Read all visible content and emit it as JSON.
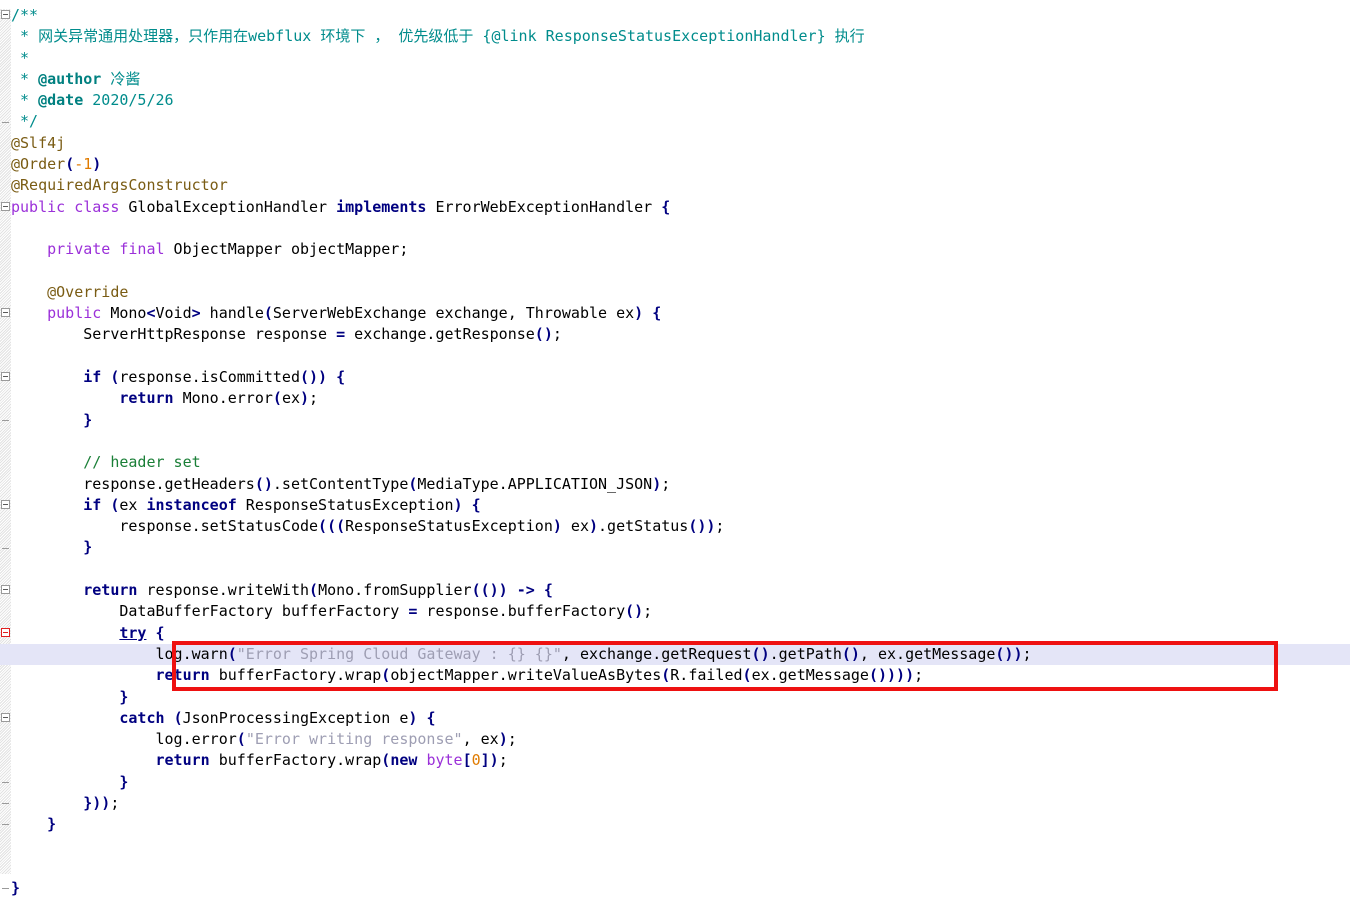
{
  "app": {
    "kind": "code-editor",
    "language": "Java",
    "theme": "light"
  },
  "colors": {
    "background": "#ffffff",
    "gutter": "#e2e2e2",
    "javadoc": "#008c8c",
    "comment": "#1a7f37",
    "annotation": "#7a5c14",
    "keyword": "#000080",
    "modifier": "#9b30d9",
    "number": "#e07b00",
    "string": "#9e9eb3",
    "line_highlight": "#e4e5f7",
    "callout_box": "#ee1111"
  },
  "callout": {
    "label": "red-highlight-box",
    "color": "#ee1111",
    "covers_lines": [
      31,
      32
    ]
  },
  "code": {
    "lines": [
      {
        "n": 1,
        "fold": "open",
        "tokens": [
          {
            "t": "/**",
            "c": "k-doc"
          }
        ]
      },
      {
        "n": 2,
        "fold": "none",
        "tokens": [
          {
            "t": " * 网关异常通用处理器，只作用在webflux 环境下 ， 优先级低于 {@link ResponseStatusExceptionHandler} 执行",
            "c": "k-doc"
          }
        ]
      },
      {
        "n": 3,
        "fold": "none",
        "tokens": [
          {
            "t": " *",
            "c": "k-doc"
          }
        ]
      },
      {
        "n": 4,
        "fold": "none",
        "tokens": [
          {
            "t": " * ",
            "c": "k-doc"
          },
          {
            "t": "@author",
            "c": "k-doctag"
          },
          {
            "t": " 冷酱",
            "c": "k-doc"
          }
        ]
      },
      {
        "n": 5,
        "fold": "none",
        "tokens": [
          {
            "t": " * ",
            "c": "k-doc"
          },
          {
            "t": "@date",
            "c": "k-doctag"
          },
          {
            "t": " 2020/5/26",
            "c": "k-doc"
          }
        ]
      },
      {
        "n": 6,
        "fold": "tick",
        "tokens": [
          {
            "t": " */",
            "c": "k-doc"
          }
        ]
      },
      {
        "n": 7,
        "fold": "none",
        "tokens": [
          {
            "t": "@Slf4j",
            "c": "k-anno"
          }
        ]
      },
      {
        "n": 8,
        "fold": "none",
        "tokens": [
          {
            "t": "@Order",
            "c": "k-anno"
          },
          {
            "t": "(",
            "c": "k-op"
          },
          {
            "t": "-1",
            "c": "k-num"
          },
          {
            "t": ")",
            "c": "k-op"
          }
        ]
      },
      {
        "n": 9,
        "fold": "none",
        "tokens": [
          {
            "t": "@RequiredArgsConstructor",
            "c": "k-anno"
          }
        ]
      },
      {
        "n": 10,
        "fold": "open",
        "tokens": [
          {
            "t": "public class",
            "c": "k-mod"
          },
          {
            "t": " GlobalExceptionHandler ",
            "c": "k-plain"
          },
          {
            "t": "implements",
            "c": "k-kw"
          },
          {
            "t": " ErrorWebExceptionHandler ",
            "c": "k-plain"
          },
          {
            "t": "{",
            "c": "k-op"
          }
        ]
      },
      {
        "n": 11,
        "fold": "none",
        "tokens": []
      },
      {
        "n": 12,
        "fold": "none",
        "tokens": [
          {
            "t": "    ",
            "c": "k-plain"
          },
          {
            "t": "private final",
            "c": "k-mod"
          },
          {
            "t": " ObjectMapper objectMapper;",
            "c": "k-plain"
          }
        ]
      },
      {
        "n": 13,
        "fold": "none",
        "tokens": []
      },
      {
        "n": 14,
        "fold": "none",
        "tokens": [
          {
            "t": "    @Override",
            "c": "k-anno"
          }
        ]
      },
      {
        "n": 15,
        "fold": "open",
        "tokens": [
          {
            "t": "    ",
            "c": "k-plain"
          },
          {
            "t": "public",
            "c": "k-mod"
          },
          {
            "t": " Mono",
            "c": "k-plain"
          },
          {
            "t": "<",
            "c": "k-op"
          },
          {
            "t": "Void",
            "c": "k-plain"
          },
          {
            "t": ">",
            "c": "k-op"
          },
          {
            "t": " handle",
            "c": "k-plain"
          },
          {
            "t": "(",
            "c": "k-op"
          },
          {
            "t": "ServerWebExchange exchange, Throwable ex",
            "c": "k-plain"
          },
          {
            "t": ")",
            "c": "k-op"
          },
          {
            "t": " ",
            "c": "k-plain"
          },
          {
            "t": "{",
            "c": "k-op"
          }
        ]
      },
      {
        "n": 16,
        "fold": "none",
        "tokens": [
          {
            "t": "        ServerHttpResponse response ",
            "c": "k-plain"
          },
          {
            "t": "=",
            "c": "k-op"
          },
          {
            "t": " exchange.getResponse",
            "c": "k-plain"
          },
          {
            "t": "()",
            "c": "k-op"
          },
          {
            "t": ";",
            "c": "k-plain"
          }
        ]
      },
      {
        "n": 17,
        "fold": "none",
        "tokens": []
      },
      {
        "n": 18,
        "fold": "open",
        "tokens": [
          {
            "t": "        ",
            "c": "k-plain"
          },
          {
            "t": "if",
            "c": "k-kw"
          },
          {
            "t": " ",
            "c": "k-plain"
          },
          {
            "t": "(",
            "c": "k-op"
          },
          {
            "t": "response.isCommitted",
            "c": "k-plain"
          },
          {
            "t": "())",
            "c": "k-op"
          },
          {
            "t": " ",
            "c": "k-plain"
          },
          {
            "t": "{",
            "c": "k-op"
          }
        ]
      },
      {
        "n": 19,
        "fold": "none",
        "tokens": [
          {
            "t": "            ",
            "c": "k-plain"
          },
          {
            "t": "return",
            "c": "k-kw"
          },
          {
            "t": " Mono.error",
            "c": "k-plain"
          },
          {
            "t": "(",
            "c": "k-op"
          },
          {
            "t": "ex",
            "c": "k-plain"
          },
          {
            "t": ")",
            "c": "k-op"
          },
          {
            "t": ";",
            "c": "k-plain"
          }
        ]
      },
      {
        "n": 20,
        "fold": "tick",
        "tokens": [
          {
            "t": "        ",
            "c": "k-plain"
          },
          {
            "t": "}",
            "c": "k-op"
          }
        ]
      },
      {
        "n": 21,
        "fold": "none",
        "tokens": []
      },
      {
        "n": 22,
        "fold": "none",
        "tokens": [
          {
            "t": "        // header set",
            "c": "k-cmt"
          }
        ]
      },
      {
        "n": 23,
        "fold": "none",
        "tokens": [
          {
            "t": "        response.getHeaders",
            "c": "k-plain"
          },
          {
            "t": "()",
            "c": "k-op"
          },
          {
            "t": ".setContentType",
            "c": "k-plain"
          },
          {
            "t": "(",
            "c": "k-op"
          },
          {
            "t": "MediaType.APPLICATION_JSON",
            "c": "k-plain"
          },
          {
            "t": ")",
            "c": "k-op"
          },
          {
            "t": ";",
            "c": "k-plain"
          }
        ]
      },
      {
        "n": 24,
        "fold": "open",
        "tokens": [
          {
            "t": "        ",
            "c": "k-plain"
          },
          {
            "t": "if",
            "c": "k-kw"
          },
          {
            "t": " ",
            "c": "k-plain"
          },
          {
            "t": "(",
            "c": "k-op"
          },
          {
            "t": "ex ",
            "c": "k-plain"
          },
          {
            "t": "instanceof",
            "c": "k-kw"
          },
          {
            "t": " ResponseStatusException",
            "c": "k-plain"
          },
          {
            "t": ")",
            "c": "k-op"
          },
          {
            "t": " ",
            "c": "k-plain"
          },
          {
            "t": "{",
            "c": "k-op"
          }
        ]
      },
      {
        "n": 25,
        "fold": "none",
        "tokens": [
          {
            "t": "            response.setStatusCode",
            "c": "k-plain"
          },
          {
            "t": "(((",
            "c": "k-op"
          },
          {
            "t": "ResponseStatusException",
            "c": "k-plain"
          },
          {
            "t": ")",
            "c": "k-op"
          },
          {
            "t": " ex",
            "c": "k-plain"
          },
          {
            "t": ")",
            "c": "k-op"
          },
          {
            "t": ".getStatus",
            "c": "k-plain"
          },
          {
            "t": "())",
            "c": "k-op"
          },
          {
            "t": ";",
            "c": "k-plain"
          }
        ]
      },
      {
        "n": 26,
        "fold": "tick",
        "tokens": [
          {
            "t": "        ",
            "c": "k-plain"
          },
          {
            "t": "}",
            "c": "k-op"
          }
        ]
      },
      {
        "n": 27,
        "fold": "none",
        "tokens": []
      },
      {
        "n": 28,
        "fold": "open",
        "tokens": [
          {
            "t": "        ",
            "c": "k-plain"
          },
          {
            "t": "return",
            "c": "k-kw"
          },
          {
            "t": " response.writeWith",
            "c": "k-plain"
          },
          {
            "t": "(",
            "c": "k-op"
          },
          {
            "t": "Mono.fromSupplier",
            "c": "k-plain"
          },
          {
            "t": "(())",
            "c": "k-op"
          },
          {
            "t": " ",
            "c": "k-plain"
          },
          {
            "t": "->",
            "c": "k-op"
          },
          {
            "t": " ",
            "c": "k-plain"
          },
          {
            "t": "{",
            "c": "k-op"
          }
        ]
      },
      {
        "n": 29,
        "fold": "none",
        "tokens": [
          {
            "t": "            DataBufferFactory bufferFactory ",
            "c": "k-plain"
          },
          {
            "t": "=",
            "c": "k-op"
          },
          {
            "t": " response.bufferFactory",
            "c": "k-plain"
          },
          {
            "t": "()",
            "c": "k-op"
          },
          {
            "t": ";",
            "c": "k-plain"
          }
        ]
      },
      {
        "n": 30,
        "fold": "open-red",
        "tokens": [
          {
            "t": "            ",
            "c": "k-plain"
          },
          {
            "t": "try",
            "c": "k-kw k-under"
          },
          {
            "t": " ",
            "c": "k-plain"
          },
          {
            "t": "{",
            "c": "k-op"
          }
        ]
      },
      {
        "n": 31,
        "fold": "none",
        "highlight": true,
        "tokens": [
          {
            "t": "                log.warn",
            "c": "k-plain"
          },
          {
            "t": "(",
            "c": "k-op"
          },
          {
            "t": "\"Error Spring Cloud Gateway : {} {}\"",
            "c": "k-str"
          },
          {
            "t": ", exchange.getRequest",
            "c": "k-plain"
          },
          {
            "t": "()",
            "c": "k-op"
          },
          {
            "t": ".getPath",
            "c": "k-plain"
          },
          {
            "t": "()",
            "c": "k-op"
          },
          {
            "t": ", ex.getMessage",
            "c": "k-plain"
          },
          {
            "t": "())",
            "c": "k-op"
          },
          {
            "t": ";",
            "c": "k-plain"
          }
        ]
      },
      {
        "n": 32,
        "fold": "none",
        "tokens": [
          {
            "t": "                ",
            "c": "k-plain"
          },
          {
            "t": "return",
            "c": "k-kw"
          },
          {
            "t": " bufferFactory.wrap",
            "c": "k-plain"
          },
          {
            "t": "(",
            "c": "k-op"
          },
          {
            "t": "objectMapper.writeValueAsBytes",
            "c": "k-plain"
          },
          {
            "t": "(",
            "c": "k-op"
          },
          {
            "t": "R.failed",
            "c": "k-plain"
          },
          {
            "t": "(",
            "c": "k-op"
          },
          {
            "t": "ex.getMessage",
            "c": "k-plain"
          },
          {
            "t": "())))",
            "c": "k-op"
          },
          {
            "t": ";",
            "c": "k-plain"
          }
        ]
      },
      {
        "n": 33,
        "fold": "none",
        "tokens": [
          {
            "t": "            ",
            "c": "k-plain"
          },
          {
            "t": "}",
            "c": "k-op"
          }
        ]
      },
      {
        "n": 34,
        "fold": "open",
        "tokens": [
          {
            "t": "            ",
            "c": "k-plain"
          },
          {
            "t": "catch",
            "c": "k-kw"
          },
          {
            "t": " ",
            "c": "k-plain"
          },
          {
            "t": "(",
            "c": "k-op"
          },
          {
            "t": "JsonProcessingException e",
            "c": "k-plain"
          },
          {
            "t": ")",
            "c": "k-op"
          },
          {
            "t": " ",
            "c": "k-plain"
          },
          {
            "t": "{",
            "c": "k-op"
          }
        ]
      },
      {
        "n": 35,
        "fold": "none",
        "tokens": [
          {
            "t": "                log.error",
            "c": "k-plain"
          },
          {
            "t": "(",
            "c": "k-op"
          },
          {
            "t": "\"Error writing response\"",
            "c": "k-str"
          },
          {
            "t": ", ex",
            "c": "k-plain"
          },
          {
            "t": ")",
            "c": "k-op"
          },
          {
            "t": ";",
            "c": "k-plain"
          }
        ]
      },
      {
        "n": 36,
        "fold": "none",
        "tokens": [
          {
            "t": "                ",
            "c": "k-plain"
          },
          {
            "t": "return",
            "c": "k-kw"
          },
          {
            "t": " bufferFactory.wrap",
            "c": "k-plain"
          },
          {
            "t": "(",
            "c": "k-op"
          },
          {
            "t": "new",
            "c": "k-kw"
          },
          {
            "t": " ",
            "c": "k-plain"
          },
          {
            "t": "byte",
            "c": "k-mod"
          },
          {
            "t": "[",
            "c": "k-op"
          },
          {
            "t": "0",
            "c": "k-num"
          },
          {
            "t": "])",
            "c": "k-op"
          },
          {
            "t": ";",
            "c": "k-plain"
          }
        ]
      },
      {
        "n": 37,
        "fold": "tick",
        "tokens": [
          {
            "t": "            ",
            "c": "k-plain"
          },
          {
            "t": "}",
            "c": "k-op"
          }
        ]
      },
      {
        "n": 38,
        "fold": "tick",
        "tokens": [
          {
            "t": "        ",
            "c": "k-plain"
          },
          {
            "t": "}))",
            "c": "k-op"
          },
          {
            "t": ";",
            "c": "k-plain"
          }
        ]
      },
      {
        "n": 39,
        "fold": "tick",
        "tokens": [
          {
            "t": "    ",
            "c": "k-plain"
          },
          {
            "t": "}",
            "c": "k-op"
          }
        ]
      },
      {
        "n": 40,
        "fold": "none",
        "tokens": []
      },
      {
        "n": 41,
        "fold": "none",
        "tokens": []
      },
      {
        "n": 42,
        "fold": "tick",
        "tokens": [
          {
            "t": "}",
            "c": "k-op"
          }
        ]
      }
    ]
  }
}
